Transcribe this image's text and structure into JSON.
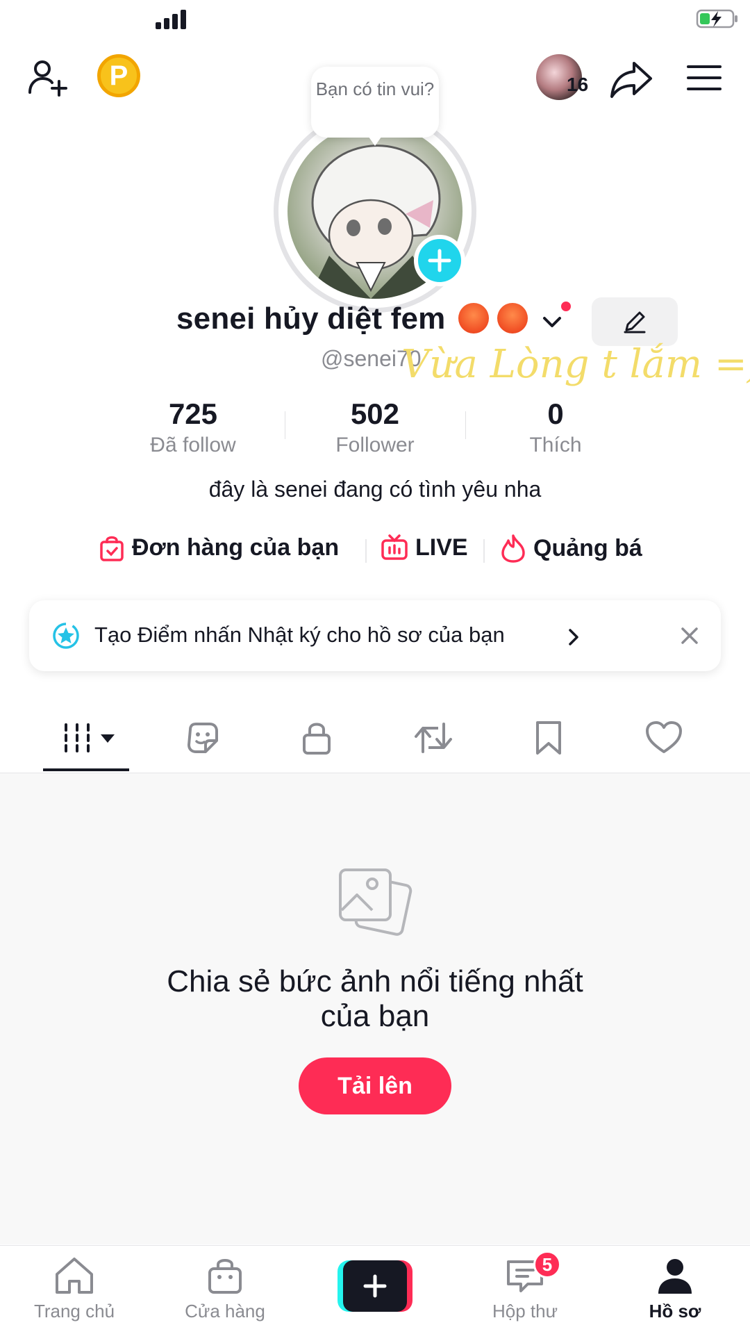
{
  "status_bar": {
    "signal_level": 4
  },
  "header": {
    "coin_label": "P",
    "notification_count": "16",
    "bubble_text": "Bạn có tin vui?"
  },
  "profile": {
    "display_name": "senei hủy diệt fem",
    "handle": "@senei70",
    "overlay_note": "Vừa Lòng t lắm =))",
    "stats": [
      {
        "value": "725",
        "label": "Đã follow"
      },
      {
        "value": "502",
        "label": "Follower"
      },
      {
        "value": "0",
        "label": "Thích"
      }
    ],
    "bio": "đây là senei đang có tình yêu nha"
  },
  "links": [
    {
      "label": "Đơn hàng của bạn",
      "icon": "shopping-bag-icon"
    },
    {
      "label": "LIVE",
      "icon": "tv-icon"
    },
    {
      "label": "Quảng bá",
      "icon": "flame-icon"
    }
  ],
  "banner": {
    "text": "Tạo Điểm nhấn Nhật ký cho hồ sơ của bạn"
  },
  "tabs": [
    "grid-icon",
    "sticker-icon",
    "lock-icon",
    "repost-icon",
    "bookmark-icon",
    "heart-icon"
  ],
  "empty_state": {
    "title_line1": "Chia sẻ bức ảnh nổi tiếng nhất",
    "title_line2": "của bạn",
    "button_label": "Tải lên"
  },
  "bottom_nav": {
    "home": "Trang chủ",
    "shop": "Cửa hàng",
    "inbox": "Hộp thư",
    "inbox_badge": "5",
    "profile": "Hồ sơ"
  },
  "colors": {
    "accent": "#fe2c55",
    "cyan": "#25f4ee",
    "text": "#161823",
    "muted": "#8a8b91"
  }
}
